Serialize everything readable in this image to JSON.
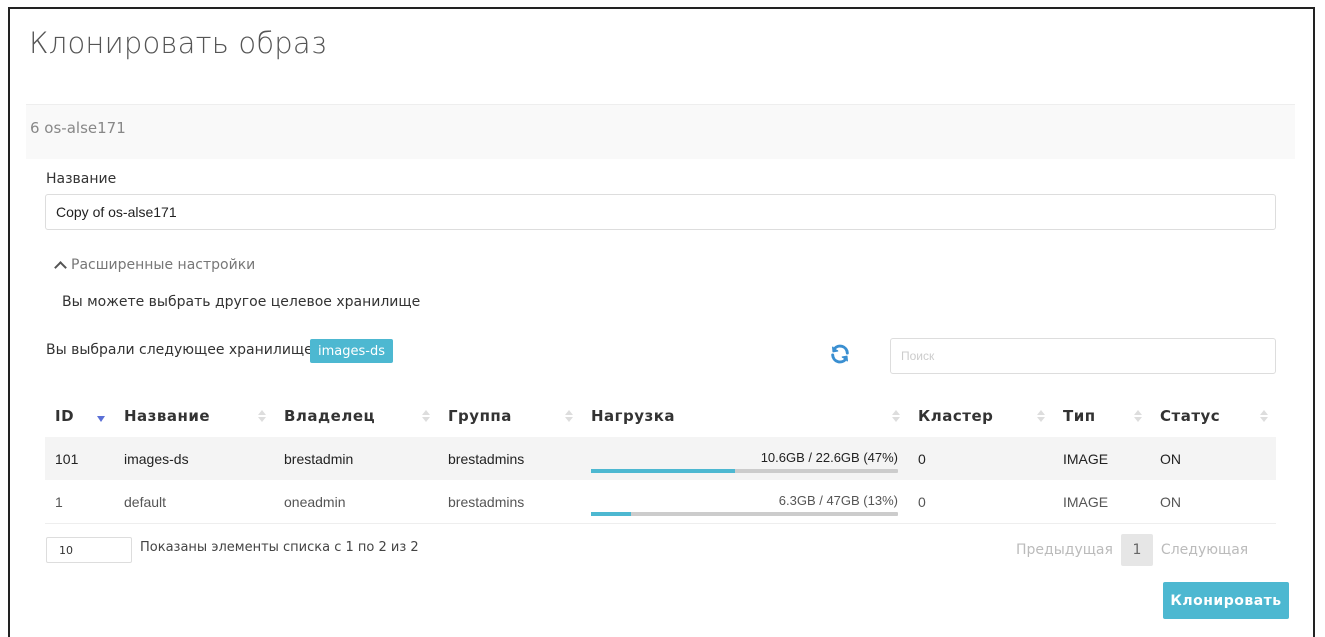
{
  "dialog": {
    "title": "Клонировать образ",
    "image_ref": "6 os-alse171"
  },
  "form": {
    "name_label": "Название",
    "name_value": "Copy of os-alse171",
    "advanced_toggle": "Расширенные настройки",
    "advanced_hint": "Вы можете выбрать другое целевое хранилище",
    "selected_label": "Вы выбрали следующее хранилище:",
    "selected_badge": "images-ds",
    "search_placeholder": "Поиск"
  },
  "table": {
    "columns": [
      "ID",
      "Название",
      "Владелец",
      "Группа",
      "Нагрузка",
      "Кластер",
      "Тип",
      "Статус"
    ],
    "rows": [
      {
        "id": "101",
        "name": "images-ds",
        "owner": "brestadmin",
        "group": "brestadmins",
        "load": "10.6GB / 22.6GB (47%)",
        "load_fraction": 0.47,
        "cluster": "0",
        "type": "IMAGE",
        "status": "ON"
      },
      {
        "id": "1",
        "name": "default",
        "owner": "oneadmin",
        "group": "brestadmins",
        "load": "6.3GB / 47GB (13%)",
        "load_fraction": 0.13,
        "cluster": "0",
        "type": "IMAGE",
        "status": "ON"
      }
    ]
  },
  "footer": {
    "page_size": "10",
    "showing": "Показаны элементы списка с 1 по 2 из 2",
    "prev": "Предыдущая",
    "current_page": "1",
    "next": "Следующая",
    "clone_button": "Клонировать"
  },
  "colors": {
    "accent": "#4db8d1",
    "sort_active": "#5a6fd6"
  }
}
